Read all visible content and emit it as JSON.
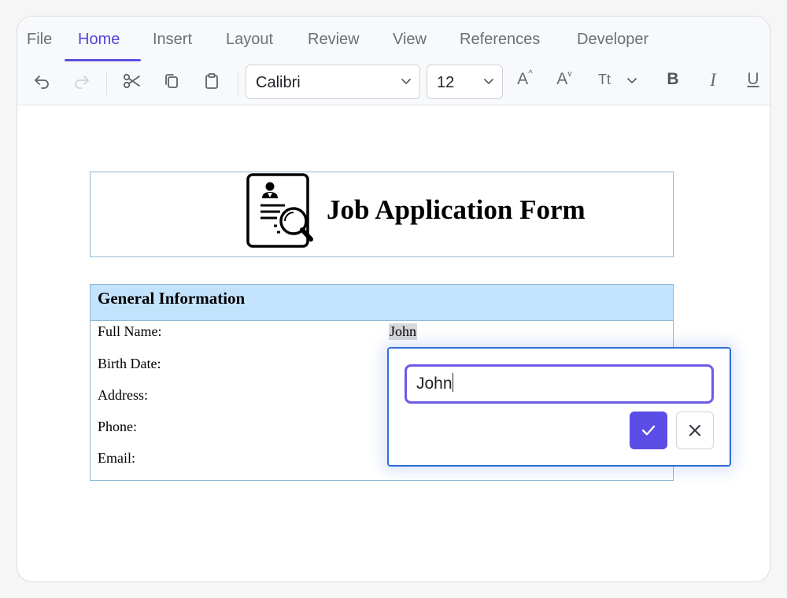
{
  "ribbon": {
    "tabs": [
      {
        "label": "File",
        "active": false
      },
      {
        "label": "Home",
        "active": true
      },
      {
        "label": "Insert",
        "active": false
      },
      {
        "label": "Layout",
        "active": false
      },
      {
        "label": "Review",
        "active": false
      },
      {
        "label": "View",
        "active": false
      },
      {
        "label": "References",
        "active": false
      },
      {
        "label": "Developer",
        "active": false
      }
    ],
    "toolbar": {
      "font_family": "Calibri",
      "font_size": "12",
      "grow_font_label": "A",
      "shrink_font_label": "A",
      "change_case_label": "Tt",
      "bold_label": "B",
      "italic_label": "I",
      "underline_label": "U",
      "icons": [
        "undo-icon",
        "redo-icon",
        "cut-icon",
        "copy-icon",
        "paste-icon",
        "chevron-down-icon"
      ]
    }
  },
  "document": {
    "title": "Job Application Form",
    "title_icon": "resume-search-icon",
    "section": {
      "header": "General Information",
      "rows": [
        {
          "label": "Full Name:",
          "value": "John"
        },
        {
          "label": "Birth Date:",
          "value": ""
        },
        {
          "label": "Address:",
          "value": ""
        },
        {
          "label": "Phone:",
          "value": ""
        },
        {
          "label": "Email:",
          "value": ""
        }
      ]
    }
  },
  "editor_popup": {
    "input_value": "John",
    "confirm_icon": "check-icon",
    "cancel_icon": "close-icon"
  },
  "colors": {
    "accent": "#5b4de6",
    "tab_active": "#5145d8",
    "section_header_bg": "#c3e2fb",
    "table_border": "#8bb8d3",
    "popup_border": "#2f6fd4"
  }
}
